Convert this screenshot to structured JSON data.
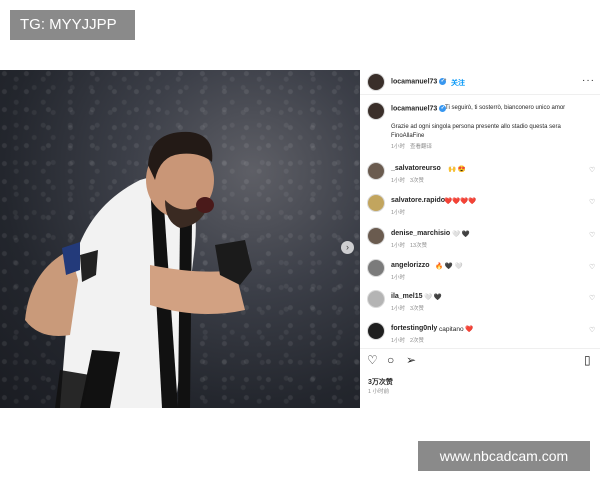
{
  "watermarks": {
    "top": "TG: MYYJJPP",
    "bottom": "www.nbcadcam.com"
  },
  "post": {
    "author": "locamanuel73",
    "follow_label": "关注",
    "more_icon": "more-horizontal-icon",
    "caption": {
      "line1": "Ti seguirò, ti sosterrò, bianconero unico amor",
      "line2": "Grazie ad ogni singola persona presente allo stadio questa sera",
      "line3": "FinoAllaFine",
      "time": "1小时",
      "translate": "查看翻译"
    },
    "comments": [
      {
        "user": "_salvatoreurso",
        "text": "🙌 😍",
        "time": "1小时",
        "reply": "回复",
        "likes": "3次赞"
      },
      {
        "user": "salvatore.rapido",
        "text": "❤️❤️❤️❤️",
        "time": "1小时",
        "reply": "回复",
        "likes": ""
      },
      {
        "user": "denise_marchisio",
        "text": "🤍 🖤",
        "time": "1小时",
        "reply": "回复",
        "likes": "13次赞"
      },
      {
        "user": "angelorizzo",
        "text": "🔥 🖤 🤍",
        "time": "1小时",
        "reply": "回复",
        "likes": ""
      },
      {
        "user": "ila_mel15",
        "text": "🤍 🖤",
        "time": "1小时",
        "reply": "回复",
        "likes": "3次赞"
      },
      {
        "user": "fortesting0nly",
        "text": "capitano ❤️",
        "time": "1小时",
        "reply": "回复",
        "likes": "2次赞"
      }
    ],
    "likes_count": "3万次赞",
    "posted_ago": "1 小时前",
    "icons": [
      "heart-icon",
      "comment-icon",
      "share-icon",
      "bookmark-icon"
    ]
  }
}
